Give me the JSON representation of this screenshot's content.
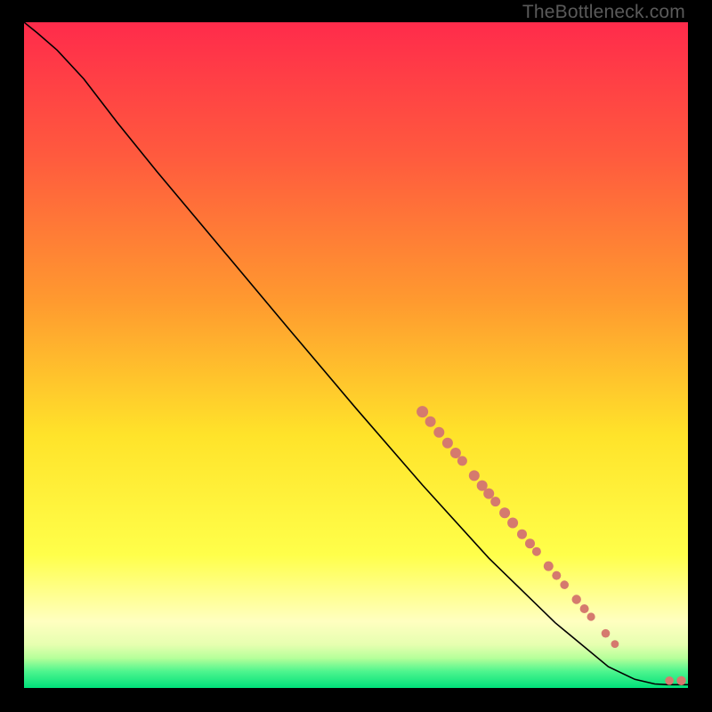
{
  "watermark": "TheBottleneck.com",
  "chart_data": {
    "type": "line",
    "title": "",
    "xlabel": "",
    "ylabel": "",
    "xlim": [
      0,
      100
    ],
    "ylim": [
      0,
      100
    ],
    "grid": false,
    "legend": false,
    "background_gradient": {
      "stops": [
        {
          "offset": 0.0,
          "color": "#ff2b4b"
        },
        {
          "offset": 0.2,
          "color": "#ff5a3e"
        },
        {
          "offset": 0.42,
          "color": "#ff9a2f"
        },
        {
          "offset": 0.62,
          "color": "#ffe32a"
        },
        {
          "offset": 0.8,
          "color": "#ffff4a"
        },
        {
          "offset": 0.9,
          "color": "#ffffc0"
        },
        {
          "offset": 0.935,
          "color": "#e6ffb0"
        },
        {
          "offset": 0.955,
          "color": "#b6ff9a"
        },
        {
          "offset": 0.975,
          "color": "#4ef58e"
        },
        {
          "offset": 1.0,
          "color": "#00e07a"
        }
      ]
    },
    "curve": [
      {
        "x": 0.0,
        "y": 100.0
      },
      {
        "x": 2.0,
        "y": 98.4
      },
      {
        "x": 5.0,
        "y": 95.8
      },
      {
        "x": 9.0,
        "y": 91.5
      },
      {
        "x": 14.0,
        "y": 85.0
      },
      {
        "x": 20.0,
        "y": 77.6
      },
      {
        "x": 30.0,
        "y": 65.7
      },
      {
        "x": 40.0,
        "y": 53.8
      },
      {
        "x": 50.0,
        "y": 42.0
      },
      {
        "x": 60.0,
        "y": 30.5
      },
      {
        "x": 70.0,
        "y": 19.5
      },
      {
        "x": 80.0,
        "y": 9.8
      },
      {
        "x": 88.0,
        "y": 3.2
      },
      {
        "x": 92.0,
        "y": 1.3
      },
      {
        "x": 95.0,
        "y": 0.6
      },
      {
        "x": 97.0,
        "y": 0.5
      },
      {
        "x": 100.0,
        "y": 0.5
      }
    ],
    "marker_color": "#d57a6e",
    "markers": [
      {
        "x": 60.0,
        "y": 41.5,
        "r": 6.5
      },
      {
        "x": 61.2,
        "y": 40.0,
        "r": 6.0
      },
      {
        "x": 62.5,
        "y": 38.4,
        "r": 6.0
      },
      {
        "x": 63.8,
        "y": 36.8,
        "r": 6.0
      },
      {
        "x": 65.0,
        "y": 35.3,
        "r": 6.0
      },
      {
        "x": 66.0,
        "y": 34.1,
        "r": 5.5
      },
      {
        "x": 67.8,
        "y": 31.9,
        "r": 6.0
      },
      {
        "x": 69.0,
        "y": 30.4,
        "r": 6.0
      },
      {
        "x": 70.0,
        "y": 29.2,
        "r": 6.0
      },
      {
        "x": 71.0,
        "y": 28.0,
        "r": 5.5
      },
      {
        "x": 72.4,
        "y": 26.3,
        "r": 6.0
      },
      {
        "x": 73.6,
        "y": 24.8,
        "r": 6.0
      },
      {
        "x": 75.0,
        "y": 23.1,
        "r": 5.5
      },
      {
        "x": 76.2,
        "y": 21.7,
        "r": 5.5
      },
      {
        "x": 77.2,
        "y": 20.5,
        "r": 5.0
      },
      {
        "x": 79.0,
        "y": 18.3,
        "r": 5.5
      },
      {
        "x": 80.2,
        "y": 16.9,
        "r": 5.0
      },
      {
        "x": 81.4,
        "y": 15.5,
        "r": 4.8
      },
      {
        "x": 83.2,
        "y": 13.3,
        "r": 5.2
      },
      {
        "x": 84.4,
        "y": 11.9,
        "r": 5.0
      },
      {
        "x": 85.4,
        "y": 10.7,
        "r": 4.6
      },
      {
        "x": 87.6,
        "y": 8.2,
        "r": 4.8
      },
      {
        "x": 89.0,
        "y": 6.6,
        "r": 4.4
      },
      {
        "x": 97.2,
        "y": 1.1,
        "r": 4.8
      },
      {
        "x": 99.0,
        "y": 1.1,
        "r": 5.2
      }
    ]
  }
}
